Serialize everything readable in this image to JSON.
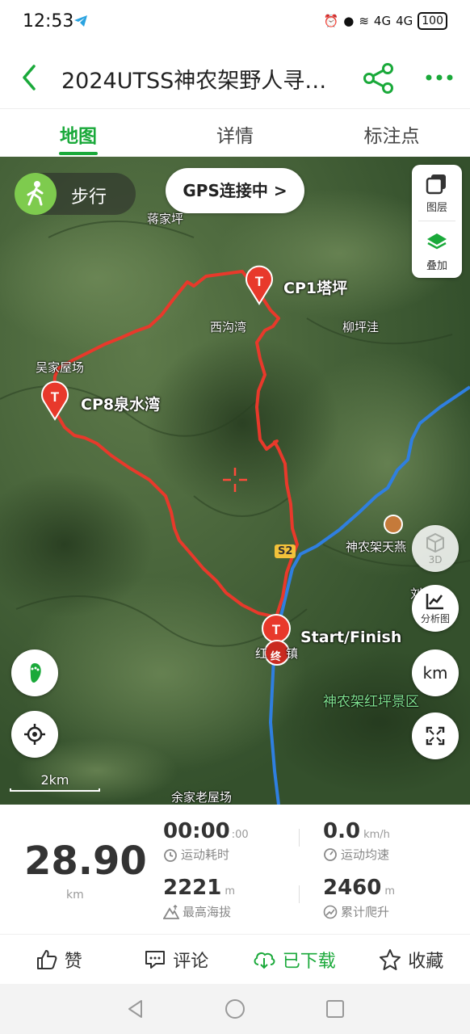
{
  "status_bar": {
    "time": "12:53",
    "signal_labels": [
      "4G",
      "4G"
    ],
    "battery": "100"
  },
  "header": {
    "title": "2024UTSS神农架野人寻…",
    "back_icon": "chevron-left-icon",
    "share_icon": "share-icon",
    "more_icon": "more-dots-icon"
  },
  "tabs": [
    {
      "label": "地图",
      "active": true
    },
    {
      "label": "详情",
      "active": false
    },
    {
      "label": "标注点",
      "active": false
    }
  ],
  "map": {
    "mode_label": "步行",
    "gps_label": "GPS连接中 >",
    "layers_label": "图层",
    "overlay_label": "叠加",
    "places": {
      "jiangjiaping": "蒋家坪",
      "xigouwan": "西沟湾",
      "liupingwa": "柳坪洼",
      "wujiawuchang": "吴家屋场",
      "shennongjia_tian": "神农架天燕",
      "liu": "刘家",
      "hong": "红",
      "zhen": "镇",
      "hongping_scenic": "神农架红坪景区",
      "yujia": "余家老屋场"
    },
    "road_label": "S2",
    "checkpoints": {
      "cp1": "CP1塔坪",
      "cp8": "CP8泉水湾",
      "start": "Start/Finish",
      "end_marker": "终"
    },
    "btn_3d": "3D",
    "btn_analysis": "分析图",
    "btn_km": "km",
    "scale_label": "2km",
    "colors": {
      "track": "#e8392b",
      "river": "#2f7fe0",
      "accent": "#1aa93a"
    }
  },
  "stats": {
    "distance": "28.90",
    "distance_unit": "km",
    "time_value": "00:00",
    "time_seconds": ":00",
    "time_label": "运动耗时",
    "speed_value": "0.0",
    "speed_unit": "km/h",
    "speed_label": "运动均速",
    "max_alt_value": "2221",
    "max_alt_unit": "m",
    "max_alt_label": "最高海拔",
    "climb_value": "2460",
    "climb_unit": "m",
    "climb_label": "累计爬升"
  },
  "actions": {
    "like": "赞",
    "comment": "评论",
    "downloaded": "已下载",
    "favorite": "收藏"
  }
}
